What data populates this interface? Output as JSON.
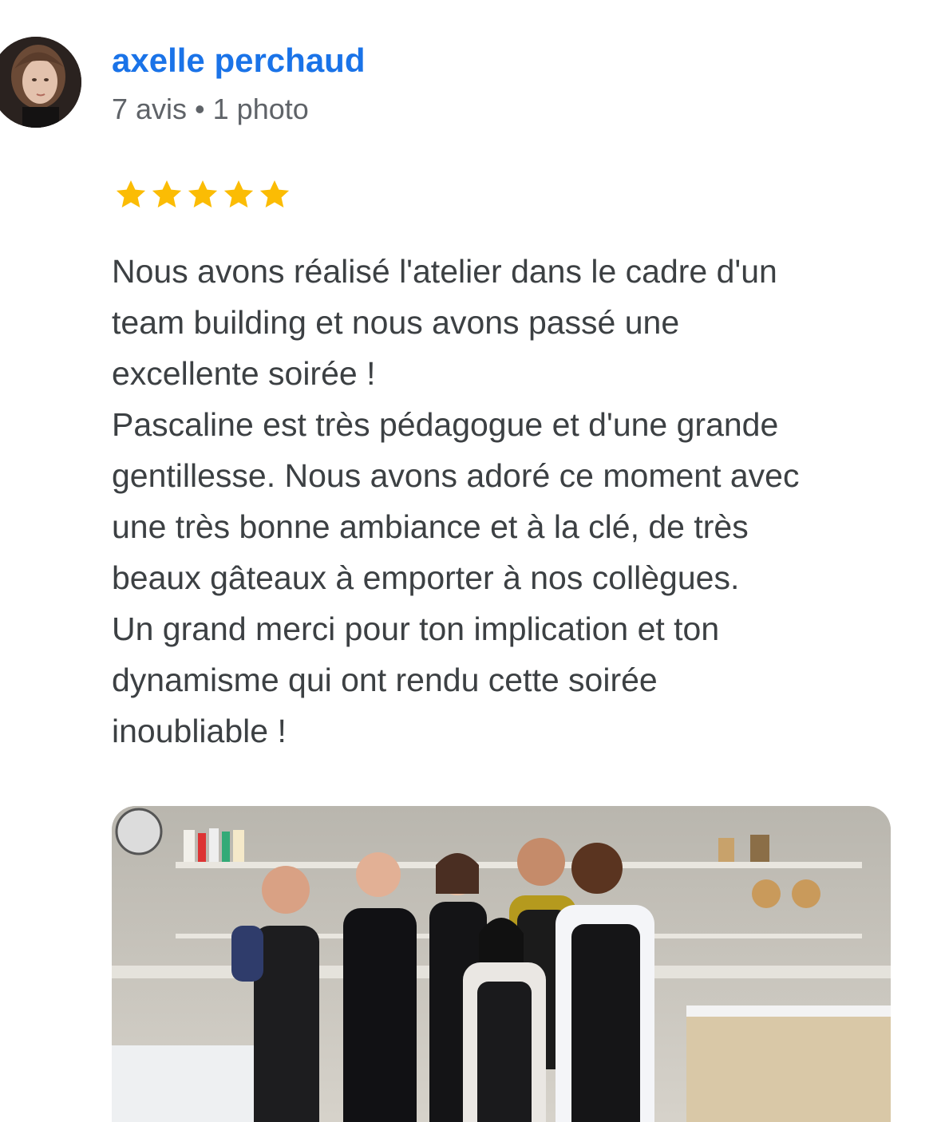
{
  "review": {
    "author_name": "axelle perchaud",
    "author_meta": "7 avis • 1 photo",
    "rating": 5,
    "rating_max": 5,
    "star_color": "#fbbc04",
    "text_lines": [
      "Nous avons réalisé l'atelier dans le cadre d'un",
      "team building et nous avons passé une",
      "excellente soirée !",
      "Pascaline est très pédagogue et d'une grande",
      "gentillesse. Nous avons adoré ce moment avec",
      "une très bonne ambiance et à la clé, de très",
      "beaux gâteaux à emporter à nos collègues.",
      "Un grand merci pour ton implication et ton",
      "dynamisme qui ont rendu cette soirée",
      "inoubliable !"
    ]
  },
  "colors": {
    "author_link": "#1a73e8",
    "meta_text": "#5f6368",
    "body_text": "#3c4043"
  },
  "icons": {
    "star": "star-icon",
    "avatar": "user-avatar"
  }
}
